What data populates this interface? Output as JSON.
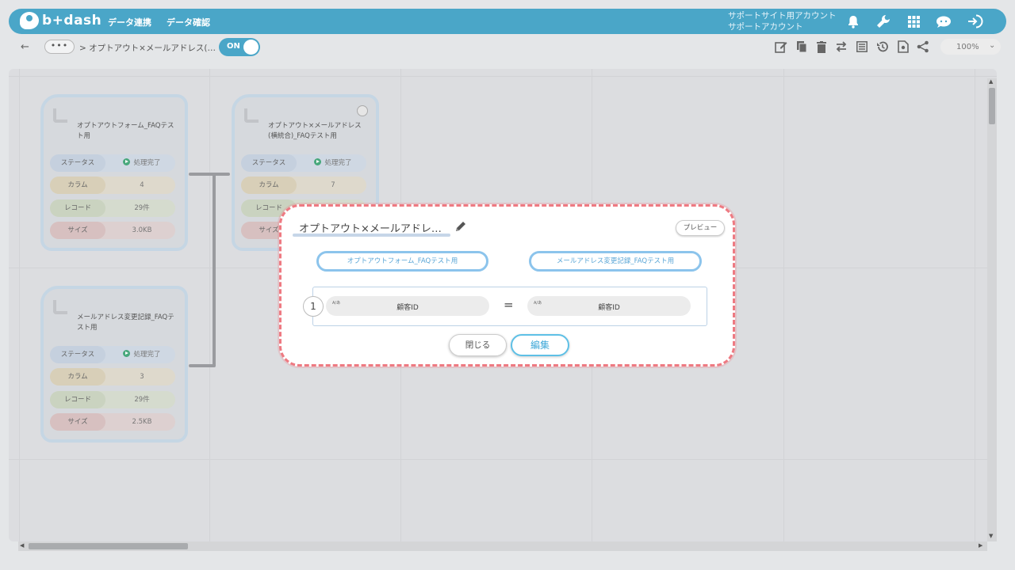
{
  "header": {
    "logo_text": "b+dash",
    "nav": [
      "データ連携",
      "データ確認"
    ],
    "account_line1": "サポートサイト用アカウント",
    "account_line2": "サポートアカウント",
    "icons": [
      "bell-icon",
      "wrench-icon",
      "apps-grid-icon",
      "chat-icon",
      "logout-icon"
    ],
    "accent_color": "#4aa6c8"
  },
  "toolbar": {
    "back_label": "←",
    "more_label": "•••",
    "breadcrumb": "> オプトアウト×メールアドレス(…",
    "toggle_label": "ON",
    "tools": [
      "edit-icon",
      "copy-icon",
      "delete-icon",
      "swap-icon",
      "list-icon",
      "history-icon",
      "export-icon",
      "share-icon"
    ],
    "zoom": "100%",
    "zoom_chevron": "⌄"
  },
  "cards": [
    {
      "title": "オプトアウトフォーム_FAQテスト用",
      "rows": [
        {
          "key": "ステータス",
          "value": "処理完了"
        },
        {
          "key": "カラム",
          "value": "4"
        },
        {
          "key": "レコード",
          "value": "29件"
        },
        {
          "key": "サイズ",
          "value": "3.0KB"
        }
      ]
    },
    {
      "title": "オプトアウト×メールアドレス(横統合)_FAQテスト用",
      "rows": [
        {
          "key": "ステータス",
          "value": "処理完了"
        },
        {
          "key": "カラム",
          "value": "7"
        },
        {
          "key": "レコード",
          "value": ""
        },
        {
          "key": "サイズ",
          "value": ""
        }
      ]
    },
    {
      "title": "メールアドレス変更記録_FAQテスト用",
      "rows": [
        {
          "key": "ステータス",
          "value": "処理完了"
        },
        {
          "key": "カラム",
          "value": "3"
        },
        {
          "key": "レコード",
          "value": "29件"
        },
        {
          "key": "サイズ",
          "value": "2.5KB"
        }
      ]
    }
  ],
  "modal": {
    "title": "オプトアウト×メールアドレ…",
    "preview_label": "プレビュー",
    "left_table": "オプトアウトフォーム_FAQテスト用",
    "right_table": "メールアドレス変更記録_FAQテスト用",
    "join_index": "1",
    "left_field_type": "A/あ",
    "left_field": "顧客ID",
    "operator": "=",
    "right_field_type": "A/あ",
    "right_field": "顧客ID",
    "close_label": "閉じる",
    "edit_label": "編集",
    "highlight_color": "#ee7a82"
  }
}
